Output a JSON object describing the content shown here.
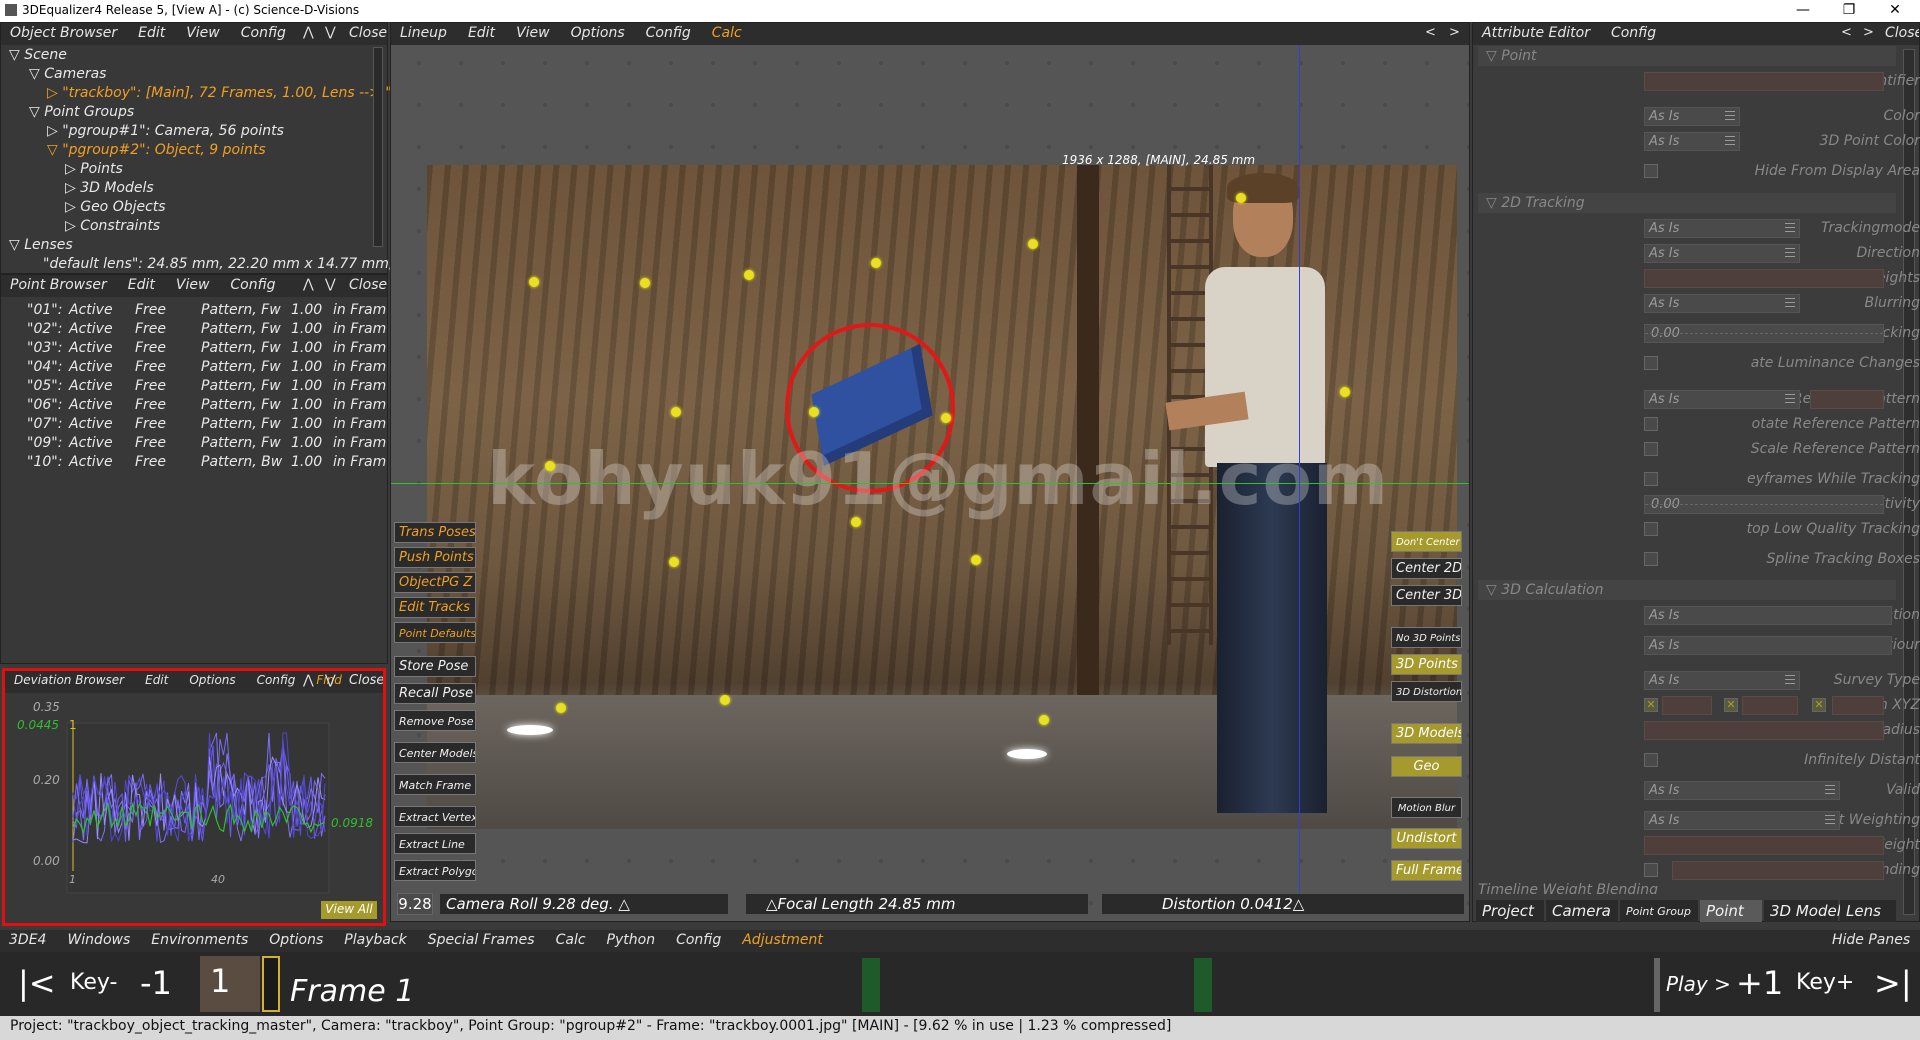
{
  "window": {
    "title": "3DEqualizer4 Release 5, [View A]  -  (c) Science-D-Visions"
  },
  "object_browser": {
    "menu": [
      "Object Browser",
      "Edit",
      "View",
      "Config"
    ],
    "close": "Close",
    "tree": {
      "scene": "Scene",
      "cameras": "Cameras",
      "camera_item": "\"trackboy\":  [Main], 72 Frames, 1.00, Lens --> \"d",
      "point_groups": "Point Groups",
      "pg1": "\"pgroup#1\":  Camera, 56 points",
      "pg2": "\"pgroup#2\":  Object, 9 points",
      "points": "Points",
      "models": "3D Models",
      "geo": "Geo Objects",
      "constraints": "Constraints",
      "lenses": "Lenses",
      "lens_item": "\"default lens\":  24.85 mm, 22.20 mm x 14.77 mm,"
    }
  },
  "point_browser": {
    "menu": [
      "Point Browser",
      "Edit",
      "View",
      "Config"
    ],
    "close": "Close",
    "rows": [
      {
        "name": "\"01\":",
        "status": "Active",
        "mode": "Free",
        "pattern": "Pattern, Fw",
        "val": "1.00",
        "frame": "in Fram"
      },
      {
        "name": "\"02\":",
        "status": "Active",
        "mode": "Free",
        "pattern": "Pattern, Fw",
        "val": "1.00",
        "frame": "in Fram"
      },
      {
        "name": "\"03\":",
        "status": "Active",
        "mode": "Free",
        "pattern": "Pattern, Fw",
        "val": "1.00",
        "frame": "in Fram"
      },
      {
        "name": "\"04\":",
        "status": "Active",
        "mode": "Free",
        "pattern": "Pattern, Fw",
        "val": "1.00",
        "frame": "in Fram"
      },
      {
        "name": "\"05\":",
        "status": "Active",
        "mode": "Free",
        "pattern": "Pattern, Fw",
        "val": "1.00",
        "frame": "in Fram"
      },
      {
        "name": "\"06\":",
        "status": "Active",
        "mode": "Free",
        "pattern": "Pattern, Fw",
        "val": "1.00",
        "frame": "in Fram"
      },
      {
        "name": "\"07\":",
        "status": "Active",
        "mode": "Free",
        "pattern": "Pattern, Fw",
        "val": "1.00",
        "frame": "in Fram"
      },
      {
        "name": "\"09\":",
        "status": "Active",
        "mode": "Free",
        "pattern": "Pattern, Fw",
        "val": "1.00",
        "frame": "in Fram"
      },
      {
        "name": "\"10\":",
        "status": "Active",
        "mode": "Free",
        "pattern": "Pattern, Bw",
        "val": "1.00",
        "frame": "in Fram"
      }
    ]
  },
  "deviation_browser": {
    "menu": [
      "Deviation Browser",
      "Edit",
      "Options",
      "Config"
    ],
    "find": "Find",
    "close": "Close",
    "y_top": "0.35",
    "y_mid": "0.20",
    "y_bot": "0.00",
    "avg_left": "0.0445",
    "avg_right": "0.0918",
    "x1": "1",
    "x40": "40",
    "frame_marker": "1",
    "view_all": "View All"
  },
  "viewport": {
    "menu": [
      "Lineup",
      "Edit",
      "View",
      "Options",
      "Config"
    ],
    "calc": "Calc",
    "info": "1936 x 1288, [MAIN], 24.85 mm",
    "watermark": "kohyuk91@gmail.com",
    "left_buttons": [
      "Trans Poses",
      "Push Points",
      "ObjectPG Z",
      "Edit Tracks",
      "Point Defaults",
      "Store Pose",
      "Recall Pose",
      "Remove Pose",
      "Center Models",
      "Match Frame",
      "Extract Vertex",
      "Extract Line",
      "Extract Polygon"
    ],
    "right_buttons": [
      "Don't Center",
      "Center 2D",
      "Center 3D",
      "No 3D Points",
      "3D Points",
      "3D Distortion",
      "3D Models",
      "Geo",
      "Motion Blur",
      "Undistort",
      "Full Frame"
    ],
    "roll_value": "9.28",
    "camera_roll": "Camera Roll 9.28 deg.",
    "focal": "Focal Length 24.85 mm",
    "distortion": "Distortion 0.0412"
  },
  "attribute_editor": {
    "menu": [
      "Attribute Editor",
      "Config"
    ],
    "close": "Close",
    "sec_point": "Point",
    "identifier": "Identifier",
    "color": "Color",
    "color_val": "As Is",
    "color3d": "3D Point Color",
    "color3d_val": "As Is",
    "hide": "Hide From Display Area",
    "sec_2d": "2D Tracking",
    "trackingmode": "Trackingmode",
    "trackingmode_val": "As Is",
    "direction": "Direction",
    "direction_val": "As Is",
    "rgb": "RGB Weights",
    "blurring": "Blurring",
    "blurring_val": "As Is",
    "deep": "Deep Tracking",
    "deep_val": "0.00",
    "lum": "ate Luminance Changes",
    "refpat": "Reference Pattern",
    "refpat_val": "As Is",
    "rotref": "otate Reference Pattern",
    "scaleref": "Scale Reference Pattern",
    "keyframes": "eyframes While Tracking",
    "sensitivity": "Sensitivity",
    "sens_val": "0.00",
    "stoplow": "top Low Quality Tracking",
    "spline": "Spline Tracking Boxes",
    "sec_3d": "3D Calculation",
    "calculation": "Calculation",
    "calc_val": "As Is",
    "triang": "Triangulation Behaviour",
    "triang_val": "As Is",
    "survey": "Survey Type",
    "survey_val": "As Is",
    "posxyz": "Position XYZ",
    "approx": "Approx. Survey Radius",
    "infinite": "Infinitely Distant",
    "valid": "Valid",
    "valid_val": "As Is",
    "weighting": "Point Weighting",
    "weighting_val": "As Is",
    "static": "Static Weight",
    "posblend": "Position Weight Blending",
    "timeline": "Timeline Weight Blending",
    "tabs": [
      "Project",
      "Camera",
      "Point Group",
      "Point",
      "3D Model",
      "Lens"
    ]
  },
  "main_menu": [
    "3DE4",
    "Windows",
    "Environments",
    "Options",
    "Playback",
    "Special Frames",
    "Calc",
    "Python",
    "Config"
  ],
  "adjustment": "Adjustment",
  "hide_panes": "Hide Panes",
  "timeline": {
    "first": "|<",
    "key_prev": "Key-",
    "minus1": "-1",
    "current": "1",
    "frame_label": "Frame 1",
    "play": "Play >",
    "plus1": "+1",
    "key_next": "Key+",
    "last": ">|"
  },
  "status": "Project: \"trackboy_object_tracking_master\", Camera: \"trackboy\", Point Group: \"pgroup#2\"  -  Frame: \"trackboy.0001.jpg\"  [MAIN]  -  [9.62 % in use | 1.23 % compressed]"
}
